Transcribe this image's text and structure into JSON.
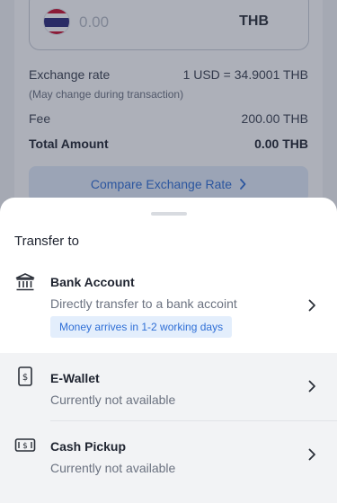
{
  "transfer_form": {
    "amount_placeholder": "0.00",
    "currency": "THB",
    "exchange_rate_label": "Exchange rate",
    "exchange_rate_value": "1 USD = 34.9001 THB",
    "exchange_rate_note": "(May change during transaction)",
    "fee_label": "Fee",
    "fee_value": "200.00 THB",
    "total_label": "Total Amount",
    "total_value": "0.00 THB",
    "compare_button": "Compare Exchange Rate"
  },
  "sheet": {
    "title": "Transfer to",
    "options": [
      {
        "title": "Bank Account",
        "subtitle": "Directly transfer to a bank accoint",
        "badge": "Money arrives in 1-2 working days",
        "icon": "bank-icon",
        "available": true
      },
      {
        "title": "E-Wallet",
        "subtitle": "Currently not available",
        "icon": "wallet-icon",
        "available": false
      },
      {
        "title": "Cash Pickup",
        "subtitle": "Currently not available",
        "icon": "cash-icon",
        "available": false
      }
    ]
  },
  "colors": {
    "accent": "#2f6fd6",
    "badge_bg": "#e3eefc",
    "disabled_bg": "#f2f3f5"
  }
}
